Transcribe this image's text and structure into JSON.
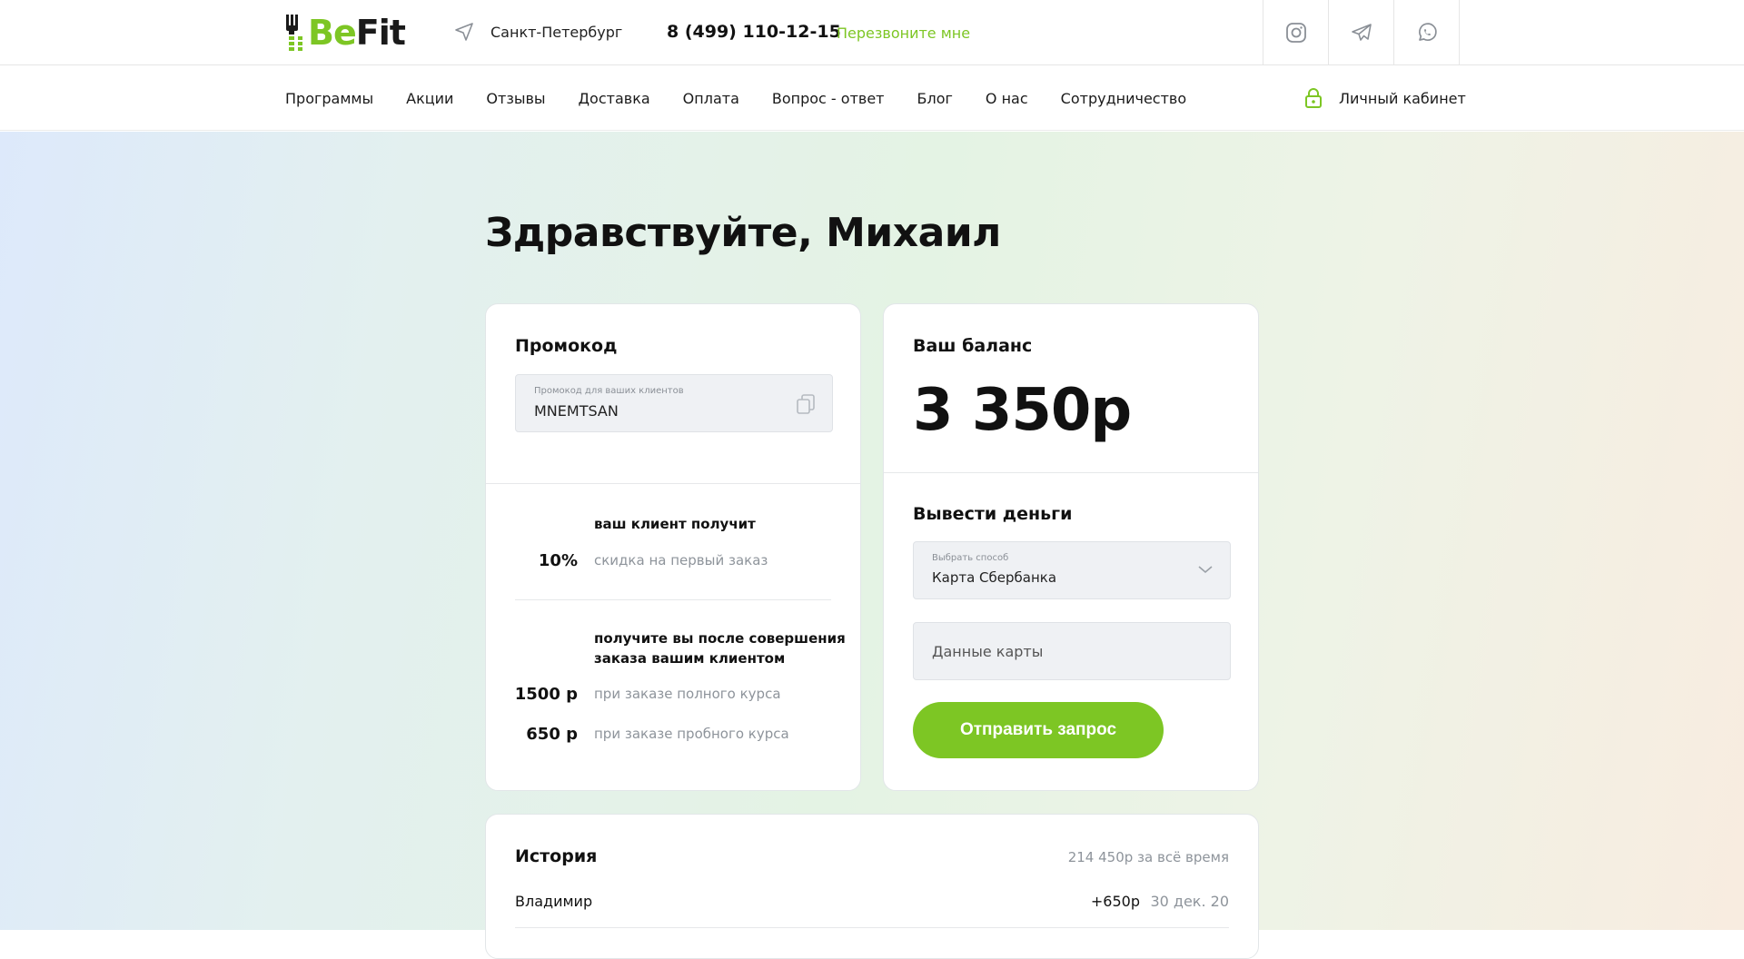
{
  "header": {
    "logo_text_be": "Be",
    "logo_text_fit": "Fit",
    "city": "Санкт-Петербург",
    "phone": "8 (499) 110-12-15",
    "callback": "Перезвоните мне",
    "socials": [
      "instagram-icon",
      "telegram-icon",
      "whatsapp-icon"
    ]
  },
  "nav": {
    "items": [
      {
        "label": "Программы"
      },
      {
        "label": "Акции"
      },
      {
        "label": "Отзывы"
      },
      {
        "label": "Доставка"
      },
      {
        "label": "Оплата"
      },
      {
        "label": "Вопрос - ответ"
      },
      {
        "label": "Блог"
      },
      {
        "label": "О нас"
      },
      {
        "label": "Сотрудничество"
      }
    ],
    "account": "Личный кабинет"
  },
  "greeting": "Здравствуйте, Михаил",
  "promo": {
    "title": "Промокод",
    "field_label": "Промокод для ваших клиентов",
    "code": "MNEMTSAN",
    "client_heading": "ваш клиент получит",
    "client_value": "10%",
    "client_desc": "скидка на первый заказ",
    "you_heading_1": "получите вы после совершения",
    "you_heading_2": "заказа вашим клиентом",
    "full_value": "1500 р",
    "full_desc": "при заказе полного курса",
    "trial_value": "650 р",
    "trial_desc": "при заказе пробного курса"
  },
  "balance": {
    "title": "Ваш баланс",
    "amount": "3 350р",
    "withdraw_title": "Вывести деньги",
    "method_label": "Выбрать способ",
    "method_value": "Карта Сбербанка",
    "card_placeholder": "Данные карты",
    "submit": "Отправить запрос"
  },
  "history": {
    "title": "История",
    "total": "214 450р за всё время",
    "rows": [
      {
        "name": "Владимир",
        "amount": "+650р",
        "date": "30 дек. 20"
      }
    ]
  },
  "colors": {
    "accent": "#7dc624",
    "text": "#111111",
    "muted": "#8e949b",
    "field_bg": "#eff1f4"
  }
}
